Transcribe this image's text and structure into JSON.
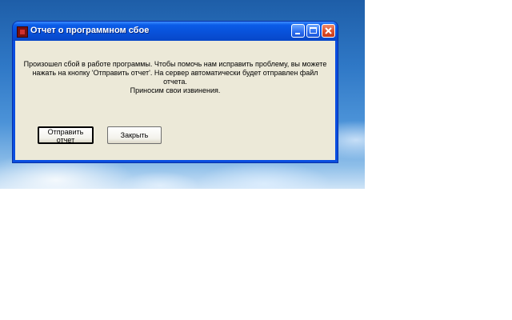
{
  "window": {
    "title": "Отчет о программном сбое",
    "message": "Произошел сбой в работе программы. Чтобы помочь нам исправить проблему, вы можете\nнажать на кнопку 'Отправить отчет'. На сервер автоматически будет отправлен файл отчета.\nПриносим свои извинения.",
    "buttons": {
      "send_label": "Отправить отчет",
      "close_label": "Закрыть"
    },
    "titlebar_icons": [
      "minimize-icon",
      "maximize-icon",
      "close-icon"
    ]
  },
  "colors": {
    "titlebar": "#0850d8",
    "client_background": "#ece9d8",
    "close_button": "#e0502a"
  }
}
